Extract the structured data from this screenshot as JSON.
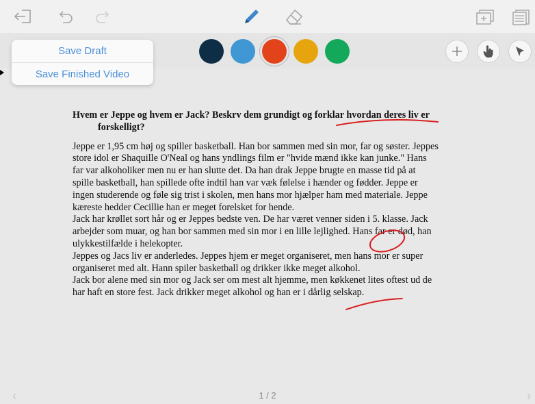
{
  "toolbar": {
    "icons": [
      "exit-icon",
      "undo-icon",
      "redo-icon",
      "pencil-icon",
      "eraser-icon",
      "add-slide-icon",
      "document-icon"
    ]
  },
  "colors": {
    "palette": [
      "#0d2e45",
      "#3f97d3",
      "#e2431b",
      "#e6a50f",
      "#14a85a"
    ],
    "selected": "#e2431b",
    "accent": "#4a90d9",
    "ink": "#d82020"
  },
  "popover": {
    "save_draft": "Save Draft",
    "save_finished": "Save Finished Video"
  },
  "tools": [
    "add-icon",
    "hand-pointer-icon",
    "cursor-arrow-icon"
  ],
  "document": {
    "question_line1": "Hvem er Jeppe og hvem er Jack? Beskrv dem grundigt og forklar hvordan deres liv er",
    "question_line2": "forskelligt?",
    "lines": [
      "Jeppe er 1,95 cm høj og spiller basketball. Han bor sammen med sin mor, far og søster. Jeppes",
      "store idol er Shaquille O'Neal og hans yndlings film er \"hvide mænd ikke kan junke.\" Hans",
      "far var alkoholiker men nu er han slutte det. Da han drak Jeppe brugte en masse tid på at",
      "spille basketball, han spillede ofte indtil han var væk følelse i hænder og fødder. Jeppe er",
      "ingen studerende og føle sig trist i skolen, men hans mor hjælper ham med materiale. Jeppe",
      "kæreste hedder Cecillie han er meget forelsket for hende.",
      "Jack har krøllet sort hår og er Jeppes bedste ven. De har været venner siden i 5. klasse. Jack",
      "arbejder som muar, og han bor sammen med sin mor i en lille lejlighed. Hans far er død, han",
      "ulykkestilfælde i helekopter.",
      "Jeppes og Jacs liv er anderledes. Jeppes hjem er meget organiseret, men hans mor er super",
      "organiseret med alt. Hann spiler basketball og drikker ikke meget alkohol.",
      "Jack bor alene med sin mor og Jack ser om mest alt hjemme, men køkkenet lites oftest ud de",
      "har haft  en store fest. Jack drikker meget alkohol og han er i dårlig selskap."
    ]
  },
  "pagination": {
    "label": "1 / 2"
  }
}
